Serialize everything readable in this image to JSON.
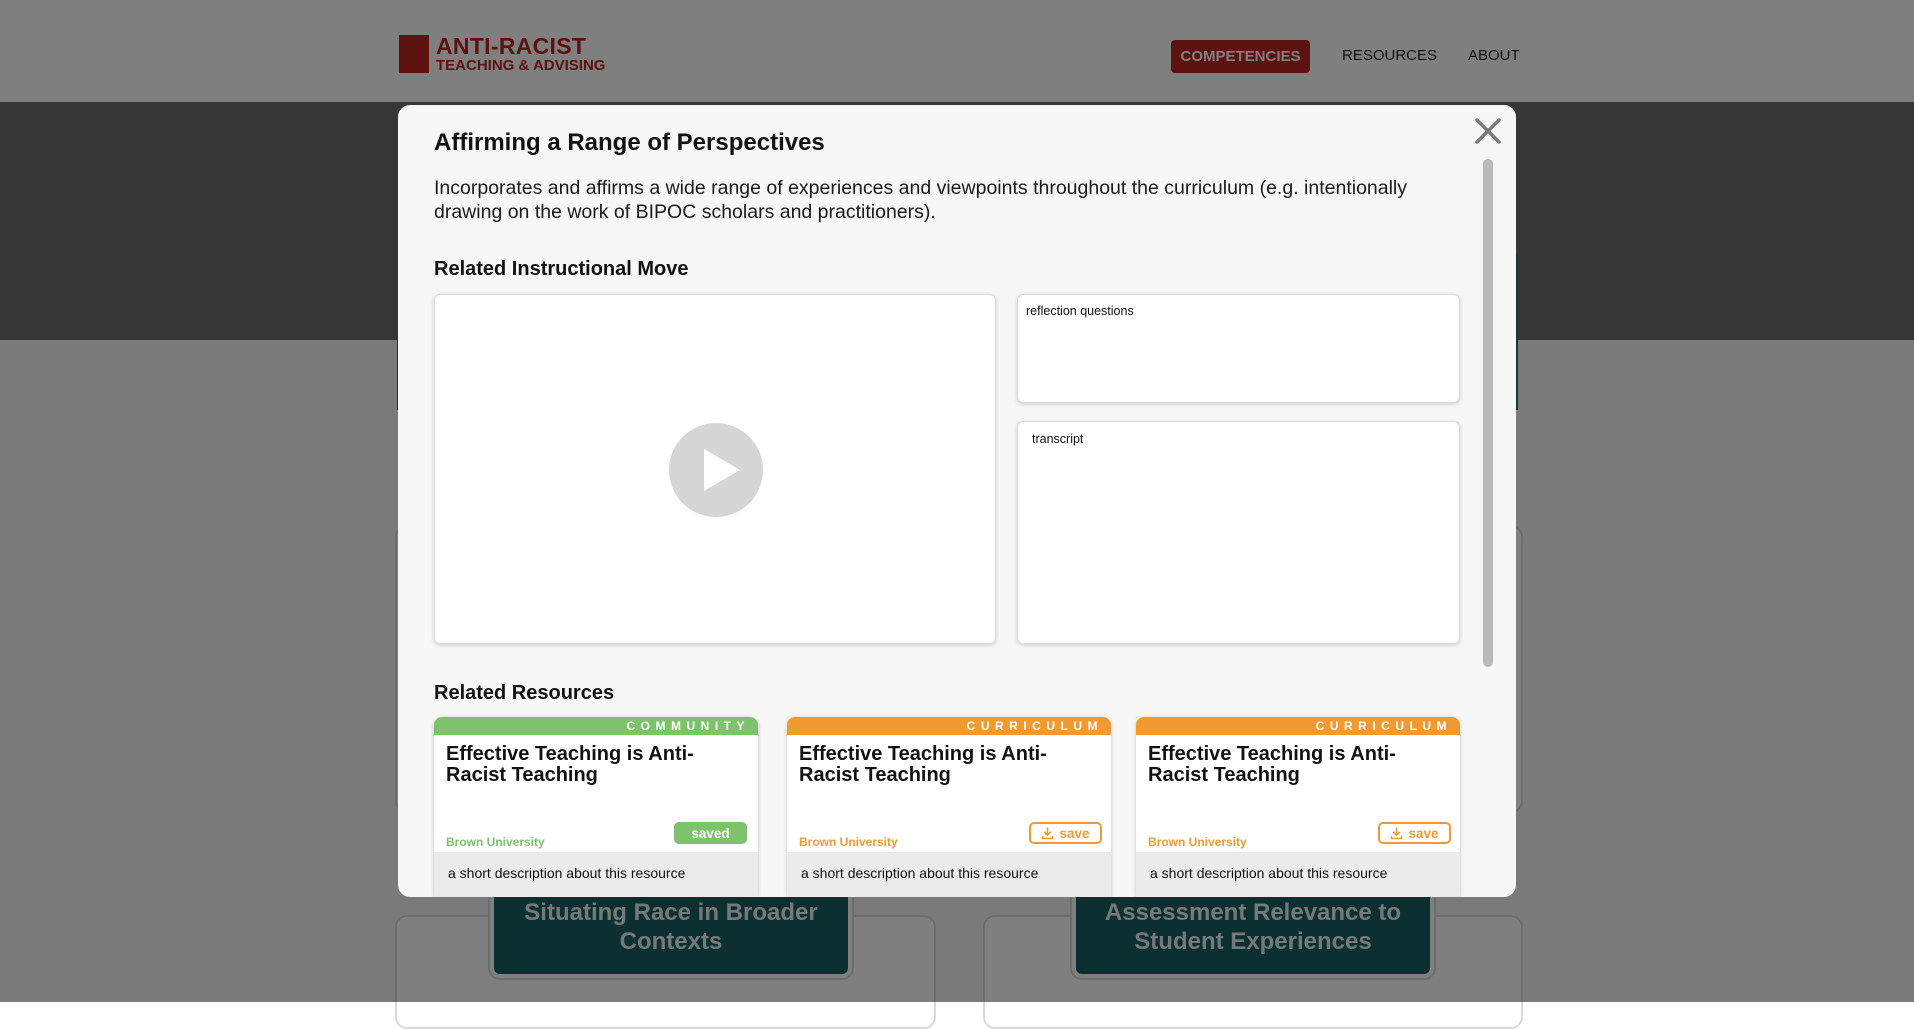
{
  "header": {
    "logo_line1": "ANTI-RACIST",
    "logo_line2": "TEACHING & ADVISING",
    "nav": [
      "COMPETENCIES",
      "RESOURCES",
      "ABOUT"
    ]
  },
  "background_cards": [
    "Situating Race in Broader Contexts",
    "Assessment Relevance to Student Experiences"
  ],
  "modal": {
    "title": "Affirming a Range of Perspectives",
    "description": "Incorporates and affirms a wide range of experiences and viewpoints throughout the curriculum (e.g. intentionally drawing on the work of BIPOC scholars and practitioners).",
    "instructional_heading": "Related Instructional Move",
    "reflection_label": "reflection questions",
    "transcript_label": "transcript",
    "resources_heading": "Related Resources",
    "resources": [
      {
        "category": "COMMUNITY",
        "title": "Effective Teaching is Anti-Racist Teaching",
        "org": "Brown University",
        "action": "saved",
        "description": "a short description about this resource",
        "color": "#7cc36b"
      },
      {
        "category": "CURRICULUM",
        "title": "Effective Teaching is Anti-Racist Teaching",
        "org": "Brown University",
        "action": "save",
        "description": "a short description about this resource",
        "color": "#f19a32"
      },
      {
        "category": "CURRICULUM",
        "title": "Effective Teaching is Anti-Racist Teaching",
        "org": "Brown University",
        "action": "save",
        "description": "a short description about this resource",
        "color": "#f19a32"
      }
    ]
  },
  "icons": [
    "close-icon",
    "play-icon",
    "download-icon"
  ],
  "colors": {
    "brand": "#b8261f",
    "teal": "#185f62",
    "community": "#7cc36b",
    "curriculum": "#f19a32"
  }
}
